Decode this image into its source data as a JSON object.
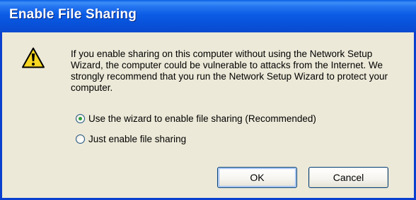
{
  "window": {
    "title": "Enable File Sharing"
  },
  "icon": {
    "name": "warning-icon",
    "fill_color": "#f8d722",
    "border_color": "#000000"
  },
  "message": "If you enable sharing on this computer without using the Network Setup Wizard, the computer could be vulnerable to attacks from the Internet. We strongly recommend that you run the Network Setup Wizard to protect your computer.",
  "options": [
    {
      "label": "Use the wizard to enable file sharing (Recommended)",
      "selected": true
    },
    {
      "label": "Just enable file sharing",
      "selected": false
    }
  ],
  "buttons": {
    "ok": "OK",
    "cancel": "Cancel"
  },
  "colors": {
    "title_bar": "#0a55dd",
    "dialog_background": "#ece9d8",
    "radio_dot": "#2f9e37"
  }
}
